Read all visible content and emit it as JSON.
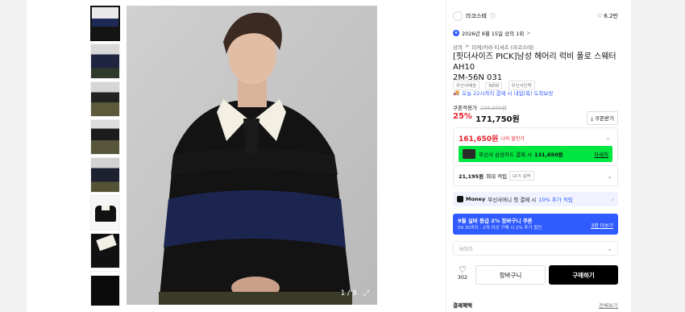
{
  "gallery": {
    "counter": "1 / 9",
    "thumb_count": 8
  },
  "brand": {
    "name": "라코스테",
    "info_glyph": "ⓘ",
    "like_count": "6.2만"
  },
  "ranking": {
    "badge_text": "2026년 9월 15일 상의 1위",
    "arrow": ">"
  },
  "breadcrumb": {
    "cat1": "상의",
    "sep": ">",
    "cat2": "피케/카라 티셔츠 (라코스테)"
  },
  "product": {
    "title_line1": "[핏더사이즈 PICK]남성 헤어리 럭비 폴로 스웨터 AH10",
    "title_line2": "2M-56N 031",
    "tags": [
      "무신사배송",
      "NEW",
      "무신사단독"
    ]
  },
  "delivery": {
    "text": "오늘 22시까지 결제 시 내일(목) 도착보장"
  },
  "price": {
    "coupon_label": "쿠폰적용가",
    "original": "229,000원",
    "discount": "25%",
    "final": "171,750원",
    "coupon_button": "쿠폰받기"
  },
  "my_price": {
    "amount": "161,650원",
    "label": "나의 할인가",
    "card_text": "무신사 삼성카드 결제 시",
    "card_price": "131,650원",
    "card_link": "자세히"
  },
  "points": {
    "amount": "21,195원",
    "label": "최대 적립",
    "level": "LV.5 실버"
  },
  "money": {
    "brand": "Money",
    "text": "무신사머니 첫 결제 시",
    "highlight": "10% 추가 적립"
  },
  "coupon_banner": {
    "title": "9월 실버 등급 2% 장바구니 쿠폰",
    "subtitle": "09.30까지 · 2개 이상 구매 시 2% 추가 할인",
    "link": "3명 더보기"
  },
  "size_select": {
    "placeholder": "사이즈"
  },
  "actions": {
    "like_count": "302",
    "cart": "장바구니",
    "buy": "구매하기"
  },
  "payment": {
    "label": "결제혜택",
    "link": "전체보기"
  },
  "colors": {
    "sale_red": "#e5222e",
    "green_card": "#00e640",
    "coupon_blue": "#2f5bff",
    "buy_black": "#000000"
  }
}
